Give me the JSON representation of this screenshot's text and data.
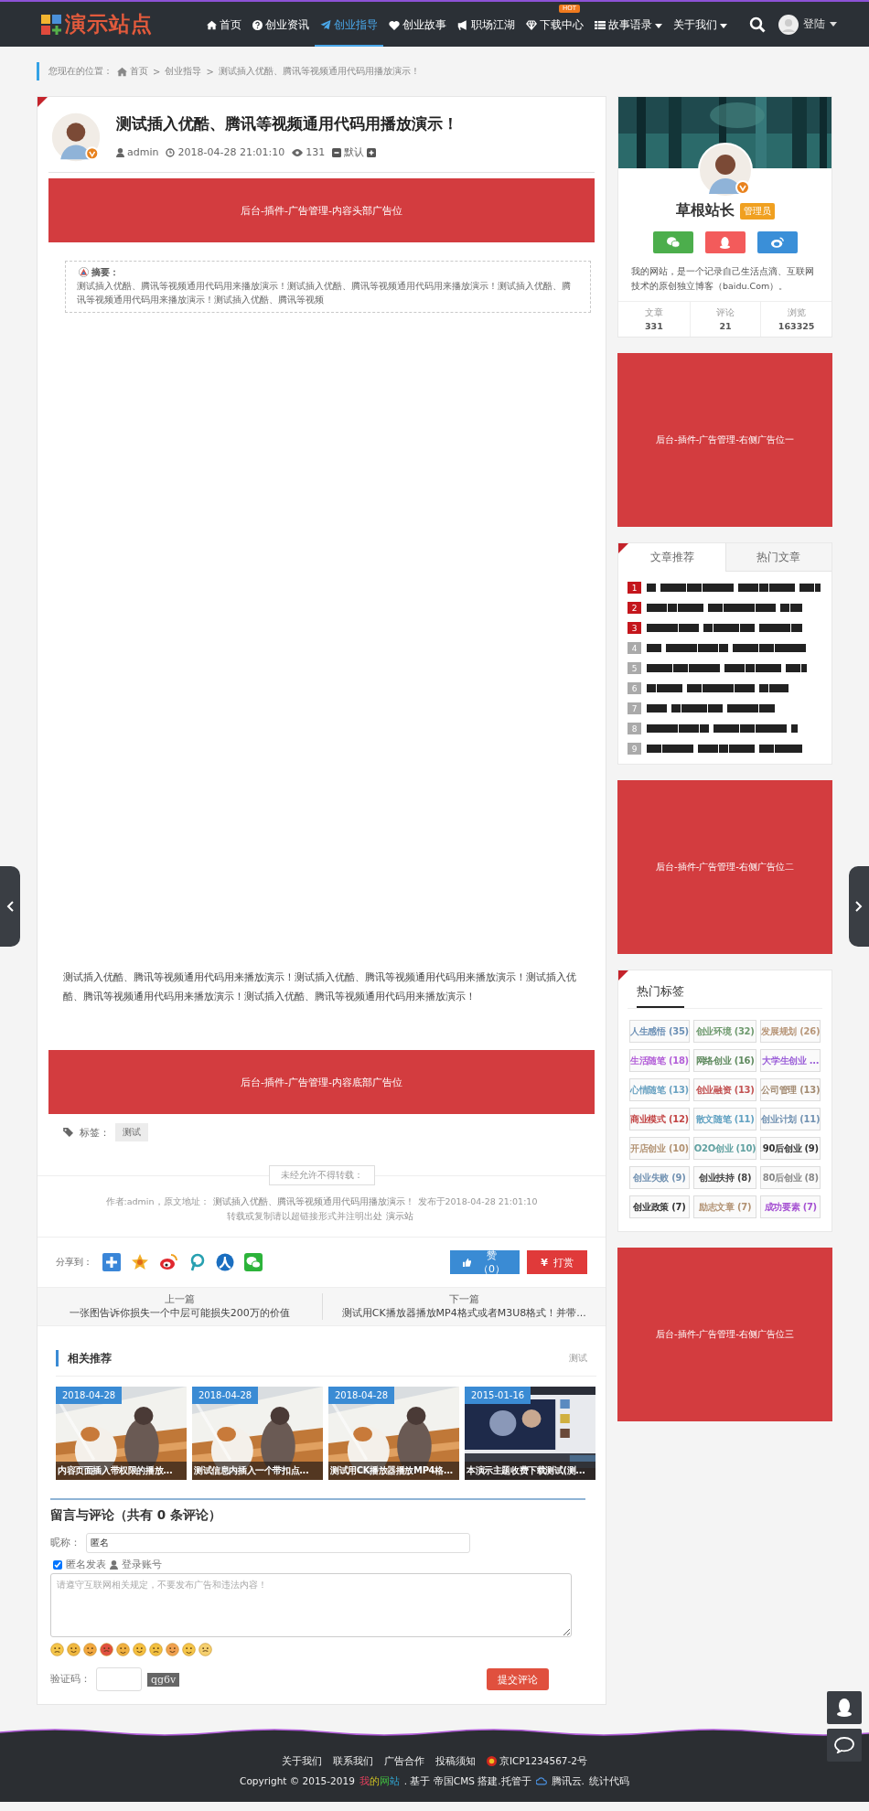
{
  "header": {
    "logo": "演示站点",
    "nav": [
      {
        "label": "首页",
        "selected": false
      },
      {
        "label": "创业资讯",
        "selected": false
      },
      {
        "label": "创业指导",
        "selected": true
      },
      {
        "label": "创业故事",
        "selected": false
      },
      {
        "label": "职场江湖",
        "selected": false
      },
      {
        "label": "下载中心",
        "selected": false,
        "badge": "HOT"
      },
      {
        "label": "故事语录",
        "selected": false,
        "dropdown": true
      },
      {
        "label": "关于我们",
        "selected": false,
        "dropdown": true
      }
    ],
    "login": "登陆"
  },
  "breadcrumb": {
    "prefix": "您现在的位置：",
    "separator": ">",
    "items": [
      "首页",
      "创业指导",
      "测试插入优酷、腾讯等视频通用代码用播放演示！"
    ]
  },
  "article": {
    "title": "测试插入优酷、腾讯等视频通用代码用播放演示！",
    "author": "admin",
    "date": "2018-04-28 21:01:10",
    "views": "131",
    "font_label": "默认",
    "top_ad": "后台-插件-广告管理-内容头部广告位",
    "summary_label": "摘要：",
    "summary": "测试插入优酷、腾讯等视频通用代码用来播放演示！测试插入优酷、腾讯等视频通用代码用来播放演示！测试插入优酷、腾讯等视频通用代码用来播放演示！测试插入优酷、腾讯等视频",
    "body": "测试插入优酷、腾讯等视频通用代码用来播放演示！测试插入优酷、腾讯等视频通用代码用来播放演示！测试插入优酷、腾讯等视频通用代码用来播放演示！测试插入优酷、腾讯等视频通用代码用来播放演示！",
    "bottom_ad": "后台-插件-广告管理-内容底部广告位",
    "tags_label": "标签：",
    "tags": [
      "测试"
    ],
    "notice": "未经允许不得转载：",
    "source_prefix": "作者:admin，原文地址：",
    "source_link": "测试插入优酷、腾讯等视频通用代码用播放演示！",
    "published": "发布于2018-04-28 21:01:10",
    "reprint_text": "转载或复制请以超链接形式并注明出处",
    "reprint_link": "演示站",
    "share_label": "分享到：",
    "like_button": "赞（0）",
    "reward_icon": "¥",
    "reward_button": "打赏",
    "prev": {
      "label": "上一篇",
      "title": "一张图告诉你损失一个中层可能损失200万的价值"
    },
    "next": {
      "label": "下一篇",
      "title": "测试用CK播放器播放MP4格式或者M3U8格式！并带..."
    }
  },
  "related": {
    "title": "相关推荐",
    "more": "测试",
    "items": [
      {
        "date": "2018-04-28",
        "caption": "内容页面插入带权限的播放...",
        "kind": "picture"
      },
      {
        "date": "2018-04-28",
        "caption": "测试信息内插入一个带扣点...",
        "kind": "picture"
      },
      {
        "date": "2018-04-28",
        "caption": "测试用CK播放器播放MP4格...",
        "kind": "picture"
      },
      {
        "date": "2015-01-16",
        "caption": "本演示主题收费下载测试(测...",
        "kind": "picture"
      }
    ]
  },
  "comments": {
    "title": "留言与评论（共有 0 条评论）",
    "nickname_label": "昵称：",
    "nickname_value": "匿名",
    "anonymous_label": "匿名发表",
    "anonymous_checked": true,
    "login_label": "登录账号",
    "placeholder": "请遵守互联网相关规定，不要发布广告和违法内容！",
    "captcha_label": "验证码：",
    "captcha_code": "qg6v",
    "submit": "提交评论"
  },
  "sidebar": {
    "profile": {
      "name": "草根站长",
      "role": "管理员",
      "description": "我的网站，是一个记录自己生活点滴、互联网技术的原创独立博客（baidu.Com）。",
      "stats": [
        {
          "label": "文章",
          "value": "331"
        },
        {
          "label": "评论",
          "value": "21"
        },
        {
          "label": "浏览",
          "value": "163325"
        }
      ]
    },
    "ads": [
      "后台-插件-广告管理-右侧广告位一",
      "后台-插件-广告管理-右侧广告位二",
      "后台-插件-广告管理-右侧广告位三"
    ],
    "tabs": [
      {
        "label": "文章推荐",
        "selected": true
      },
      {
        "label": "热门文章",
        "selected": false
      }
    ],
    "ranked": [
      {
        "rank": "1",
        "highlighted": true
      },
      {
        "rank": "2",
        "highlighted": true
      },
      {
        "rank": "3",
        "highlighted": true
      },
      {
        "rank": "4",
        "highlighted": false
      },
      {
        "rank": "5",
        "highlighted": false
      },
      {
        "rank": "6",
        "highlighted": false
      },
      {
        "rank": "7",
        "highlighted": false
      },
      {
        "rank": "8",
        "highlighted": false
      },
      {
        "rank": "9",
        "highlighted": false
      }
    ],
    "tags_title": "热门标签",
    "tags": [
      {
        "label": "人生感悟 (35)",
        "color": "#6b8fb5"
      },
      {
        "label": "创业环境 (32)",
        "color": "#6f9a6f"
      },
      {
        "label": "发展规划 (26)",
        "color": "#b8977a"
      },
      {
        "label": "生活随笔 (18)",
        "color": "#b35fd8"
      },
      {
        "label": "网络创业 (16)",
        "color": "#5f8a5f"
      },
      {
        "label": "大学生创业 ...",
        "color": "#9b5fd8"
      },
      {
        "label": "心情随笔 (13)",
        "color": "#6aa2c2"
      },
      {
        "label": "创业融资 (13)",
        "color": "#c25252"
      },
      {
        "label": "公司管理 (13)",
        "color": "#a38b72"
      },
      {
        "label": "商业模式 (12)",
        "color": "#c24444"
      },
      {
        "label": "散文随笔 (11)",
        "color": "#62a2c2"
      },
      {
        "label": "创业计划 (11)",
        "color": "#7292b2"
      },
      {
        "label": "开店创业 (10)",
        "color": "#b29272"
      },
      {
        "label": "O2O创业 (10)",
        "color": "#62a2a2"
      },
      {
        "label": "90后创业 (9)",
        "color": "#333333"
      },
      {
        "label": "创业失败 (9)",
        "color": "#7292b2"
      },
      {
        "label": "创业扶持 (8)",
        "color": "#444444"
      },
      {
        "label": "80后创业 (8)",
        "color": "#888888"
      },
      {
        "label": "创业政策 (7)",
        "color": "#333334"
      },
      {
        "label": "励志文章 (7)",
        "color": "#b29273"
      },
      {
        "label": "成功要素 (7)",
        "color": "#a552d2"
      }
    ]
  },
  "footer": {
    "links": [
      "关于我们",
      "联系我们",
      "广告合作",
      "投稿须知"
    ],
    "icp": "京ICP1234567-2号",
    "copyright": "Copyright © 2015-2019",
    "site_name": "我的网站",
    "built": ". 基于 帝国CMS 搭建.托管于",
    "host": "腾讯云.",
    "stats": "统计代码"
  }
}
